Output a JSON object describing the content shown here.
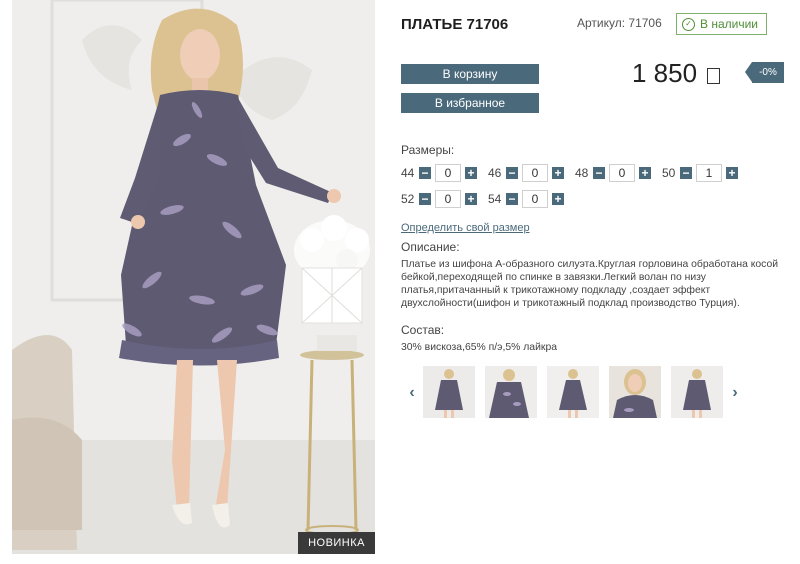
{
  "product": {
    "title": "ПЛАТЬЕ 71706",
    "sku": "Артикул: 71706",
    "stock": "В наличии",
    "price": "1 850",
    "discount": "-0%"
  },
  "photo": {
    "badge": "НОВИНКА"
  },
  "actions": {
    "cart_label": "В корзину",
    "fav_label": "В избранное"
  },
  "sizes": {
    "label": "Размеры:",
    "items": [
      {
        "size": "44",
        "qty": "0"
      },
      {
        "size": "46",
        "qty": "0"
      },
      {
        "size": "48",
        "qty": "0"
      },
      {
        "size": "50",
        "qty": "1"
      },
      {
        "size": "52",
        "qty": "0"
      },
      {
        "size": "54",
        "qty": "0"
      }
    ],
    "link": "Определить свой размер",
    "minus": "−",
    "plus": "+"
  },
  "description": {
    "label": "Описание:",
    "text": "Платье из шифона А-образного силуэта.Круглая горловина обработана косой бейкой,переходящей по спинке в завязки.Легкий волан по низу платья,притачанный к трикотажному подкладу ,создает эффект двухслойности(шифон и трикотажный подклад производство Турция)."
  },
  "composition": {
    "label": "Состав:",
    "text": "30% вискоза,65% п/э,5% лайкра"
  },
  "gallery": {
    "prev_icon": "‹",
    "next_icon": "›",
    "thumb_count": 5
  },
  "colors": {
    "accent": "#4a6a7c",
    "stock_green": "#4f8f36",
    "dress": "#5d5a72",
    "badge_bg": "#3a3a3a"
  }
}
